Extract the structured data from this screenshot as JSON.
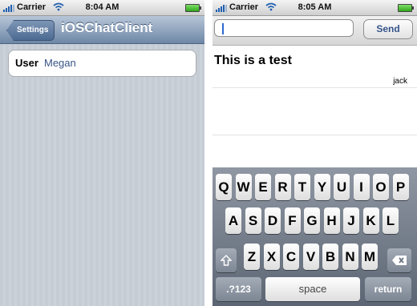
{
  "left_screen": {
    "status": {
      "carrier": "Carrier",
      "time": "8:04 AM"
    },
    "nav": {
      "back_label": "Settings",
      "title": "iOSChatClient"
    },
    "user_row": {
      "label": "User",
      "value": "Megan"
    }
  },
  "right_screen": {
    "status": {
      "carrier": "Carrier",
      "time": "8:05 AM"
    },
    "message_input": {
      "value": ""
    },
    "send_label": "Send",
    "messages": [
      {
        "text": "This is a test",
        "author": "jack"
      }
    ],
    "keyboard": {
      "row1": [
        "Q",
        "W",
        "E",
        "R",
        "T",
        "Y",
        "U",
        "I",
        "O",
        "P"
      ],
      "row2": [
        "A",
        "S",
        "D",
        "F",
        "G",
        "H",
        "J",
        "K",
        "L"
      ],
      "row3": [
        "Z",
        "X",
        "C",
        "V",
        "B",
        "N",
        "M"
      ],
      "numbers_label": ".?123",
      "space_label": "space",
      "return_label": "return",
      "shift_icon": "shift-arrow-icon",
      "delete_icon": "backspace-icon"
    }
  },
  "colors": {
    "nav_bar": "#6e87a6",
    "link_text": "#385487",
    "keyboard_bg": "#6b7380",
    "signal": "#1f5fb0"
  }
}
